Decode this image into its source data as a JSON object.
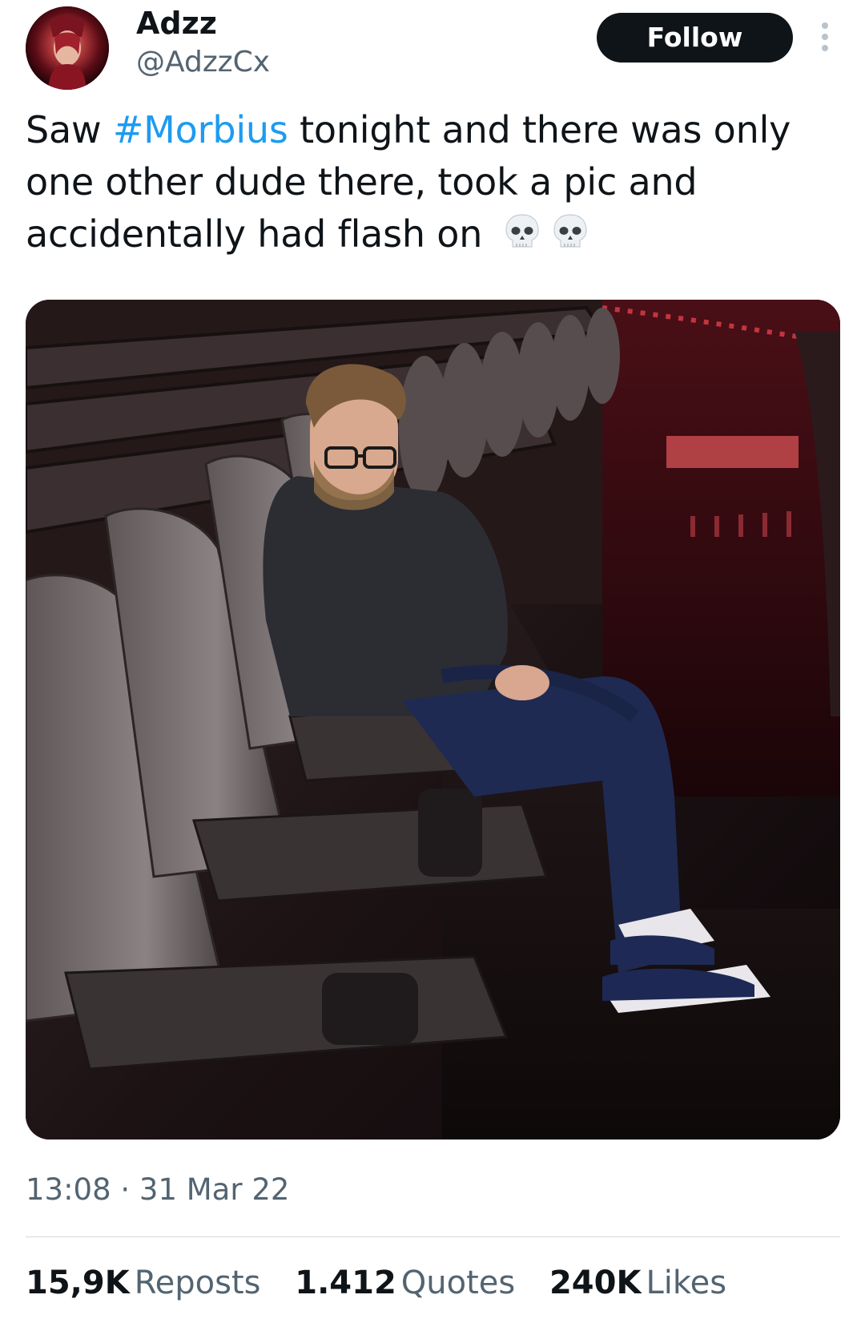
{
  "tweet": {
    "author": {
      "display_name": "Adzz",
      "handle": "@AdzzCx"
    },
    "follow_label": "Follow",
    "text_before": "Saw ",
    "hashtag": "#Morbius",
    "text_after": " tonight and there was only one other dude there, took a pic and accidentally had flash on",
    "emoji": "skull-emoji x2",
    "media_icon": "photo",
    "timestamp": "13:08 · 31 Mar 22",
    "stats": [
      {
        "value": "15,9K",
        "label": "Reposts"
      },
      {
        "value": "1.412",
        "label": "Quotes"
      },
      {
        "value": "240K",
        "label": "Likes"
      }
    ]
  },
  "colors": {
    "text": "#0f1419",
    "secondary": "#536471",
    "link": "#1d9bf0",
    "follow_bg": "#0f1419",
    "divider": "#cfd9de"
  },
  "icons": {
    "more": "more-vertical-icon",
    "emoji": "skull-icon"
  }
}
